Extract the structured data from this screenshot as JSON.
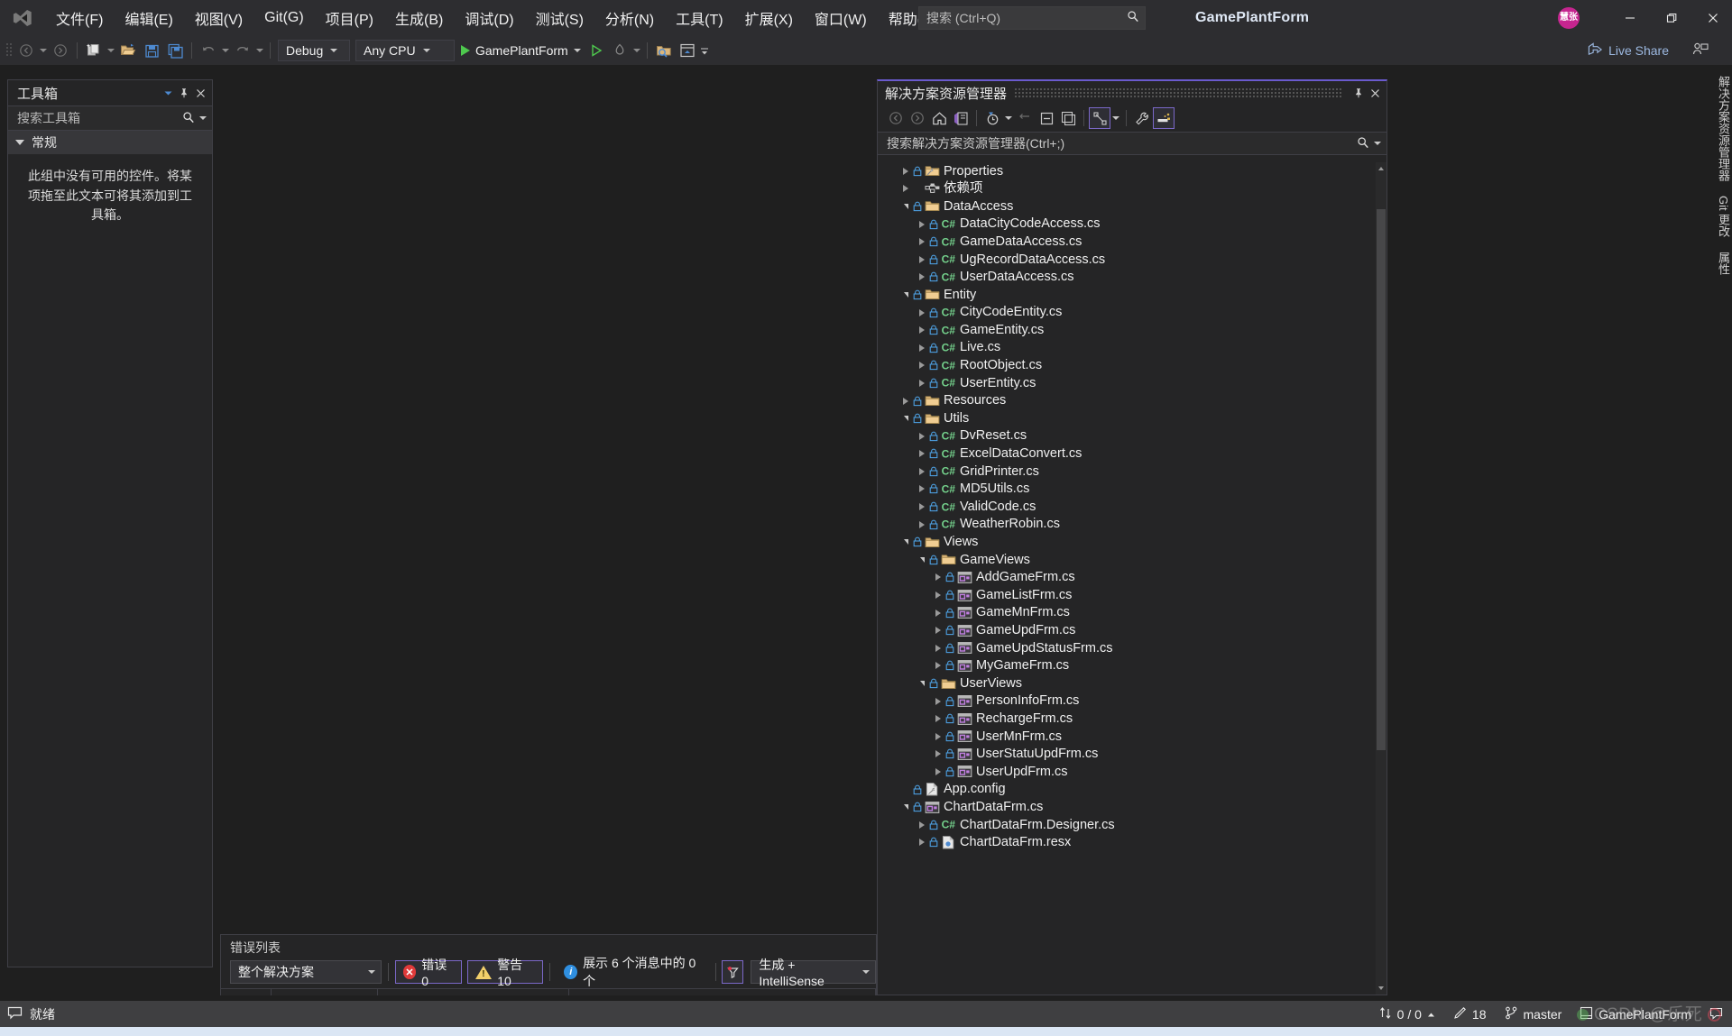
{
  "window": {
    "title": "GamePlantForm",
    "avatar_initials": "慧张",
    "minimize": "—",
    "maximize": "❐",
    "close": "✕"
  },
  "menu": {
    "items": [
      {
        "label": "文件(F)",
        "name": "menu-file"
      },
      {
        "label": "编辑(E)",
        "name": "menu-edit"
      },
      {
        "label": "视图(V)",
        "name": "menu-view"
      },
      {
        "label": "Git(G)",
        "name": "menu-git"
      },
      {
        "label": "项目(P)",
        "name": "menu-project"
      },
      {
        "label": "生成(B)",
        "name": "menu-build"
      },
      {
        "label": "调试(D)",
        "name": "menu-debug"
      },
      {
        "label": "测试(S)",
        "name": "menu-test"
      },
      {
        "label": "分析(N)",
        "name": "menu-analyze"
      },
      {
        "label": "工具(T)",
        "name": "menu-tools"
      },
      {
        "label": "扩展(X)",
        "name": "menu-extensions"
      },
      {
        "label": "窗口(W)",
        "name": "menu-window"
      },
      {
        "label": "帮助(H)",
        "name": "menu-help"
      }
    ]
  },
  "quick_search": {
    "placeholder": "搜索 (Ctrl+Q)",
    "icon": "search-icon"
  },
  "toolbar": {
    "configuration": "Debug",
    "platform": "Any CPU",
    "start_label": "GamePlantForm",
    "live_share": "Live Share"
  },
  "toolbox": {
    "title": "工具箱",
    "search_placeholder": "搜索工具箱",
    "group_label": "常规",
    "empty_message": "此组中没有可用的控件。将某项拖至此文本可将其添加到工具箱。"
  },
  "solution_explorer": {
    "title": "解决方案资源管理器",
    "search_placeholder": "搜索解决方案资源管理器(Ctrl+;)",
    "tree": [
      {
        "label": "Properties",
        "depth": 1,
        "state": "collapsed",
        "icon": "properties-folder-icon",
        "lock": true
      },
      {
        "label": "依赖项",
        "depth": 1,
        "state": "collapsed",
        "icon": "dependencies-icon",
        "lock": false
      },
      {
        "label": "DataAccess",
        "depth": 1,
        "state": "expanded",
        "icon": "folder-icon",
        "lock": true
      },
      {
        "label": "DataCityCodeAccess.cs",
        "depth": 2,
        "state": "collapsed",
        "icon": "csharp-icon",
        "lock": true
      },
      {
        "label": "GameDataAccess.cs",
        "depth": 2,
        "state": "collapsed",
        "icon": "csharp-icon",
        "lock": true
      },
      {
        "label": "UgRecordDataAccess.cs",
        "depth": 2,
        "state": "collapsed",
        "icon": "csharp-icon",
        "lock": true
      },
      {
        "label": "UserDataAccess.cs",
        "depth": 2,
        "state": "collapsed",
        "icon": "csharp-icon",
        "lock": true
      },
      {
        "label": "Entity",
        "depth": 1,
        "state": "expanded",
        "icon": "folder-icon",
        "lock": true
      },
      {
        "label": "CityCodeEntity.cs",
        "depth": 2,
        "state": "collapsed",
        "icon": "csharp-icon",
        "lock": true
      },
      {
        "label": "GameEntity.cs",
        "depth": 2,
        "state": "collapsed",
        "icon": "csharp-icon",
        "lock": true
      },
      {
        "label": "Live.cs",
        "depth": 2,
        "state": "collapsed",
        "icon": "csharp-icon",
        "lock": true
      },
      {
        "label": "RootObject.cs",
        "depth": 2,
        "state": "collapsed",
        "icon": "csharp-icon",
        "lock": true
      },
      {
        "label": "UserEntity.cs",
        "depth": 2,
        "state": "collapsed",
        "icon": "csharp-icon",
        "lock": true
      },
      {
        "label": "Resources",
        "depth": 1,
        "state": "collapsed",
        "icon": "folder-icon",
        "lock": true
      },
      {
        "label": "Utils",
        "depth": 1,
        "state": "expanded",
        "icon": "folder-icon",
        "lock": true
      },
      {
        "label": "DvReset.cs",
        "depth": 2,
        "state": "collapsed",
        "icon": "csharp-icon",
        "lock": true
      },
      {
        "label": "ExcelDataConvert.cs",
        "depth": 2,
        "state": "collapsed",
        "icon": "csharp-icon",
        "lock": true
      },
      {
        "label": "GridPrinter.cs",
        "depth": 2,
        "state": "collapsed",
        "icon": "csharp-icon",
        "lock": true
      },
      {
        "label": "MD5Utils.cs",
        "depth": 2,
        "state": "collapsed",
        "icon": "csharp-icon",
        "lock": true
      },
      {
        "label": "ValidCode.cs",
        "depth": 2,
        "state": "collapsed",
        "icon": "csharp-icon",
        "lock": true
      },
      {
        "label": "WeatherRobin.cs",
        "depth": 2,
        "state": "collapsed",
        "icon": "csharp-icon",
        "lock": true
      },
      {
        "label": "Views",
        "depth": 1,
        "state": "expanded",
        "icon": "folder-icon",
        "lock": true
      },
      {
        "label": "GameViews",
        "depth": 2,
        "state": "expanded",
        "icon": "folder-icon",
        "lock": true
      },
      {
        "label": "AddGameFrm.cs",
        "depth": 3,
        "state": "collapsed",
        "icon": "winform-icon",
        "lock": true
      },
      {
        "label": "GameListFrm.cs",
        "depth": 3,
        "state": "collapsed",
        "icon": "winform-icon",
        "lock": true
      },
      {
        "label": "GameMnFrm.cs",
        "depth": 3,
        "state": "collapsed",
        "icon": "winform-icon",
        "lock": true
      },
      {
        "label": "GameUpdFrm.cs",
        "depth": 3,
        "state": "collapsed",
        "icon": "winform-icon",
        "lock": true
      },
      {
        "label": "GameUpdStatusFrm.cs",
        "depth": 3,
        "state": "collapsed",
        "icon": "winform-icon",
        "lock": true
      },
      {
        "label": "MyGameFrm.cs",
        "depth": 3,
        "state": "collapsed",
        "icon": "winform-icon",
        "lock": true
      },
      {
        "label": "UserViews",
        "depth": 2,
        "state": "expanded",
        "icon": "folder-icon",
        "lock": true
      },
      {
        "label": "PersonInfoFrm.cs",
        "depth": 3,
        "state": "collapsed",
        "icon": "winform-icon",
        "lock": true
      },
      {
        "label": "RechargeFrm.cs",
        "depth": 3,
        "state": "collapsed",
        "icon": "winform-icon",
        "lock": true
      },
      {
        "label": "UserMnFrm.cs",
        "depth": 3,
        "state": "collapsed",
        "icon": "winform-icon",
        "lock": true
      },
      {
        "label": "UserStatuUpdFrm.cs",
        "depth": 3,
        "state": "collapsed",
        "icon": "winform-icon",
        "lock": true
      },
      {
        "label": "UserUpdFrm.cs",
        "depth": 3,
        "state": "collapsed",
        "icon": "winform-icon",
        "lock": true
      },
      {
        "label": "App.config",
        "depth": 1,
        "state": "leaf",
        "icon": "config-icon",
        "lock": true
      },
      {
        "label": "ChartDataFrm.cs",
        "depth": 1,
        "state": "expanded",
        "icon": "winform-icon",
        "lock": true
      },
      {
        "label": "ChartDataFrm.Designer.cs",
        "depth": 2,
        "state": "collapsed",
        "icon": "csharp-icon",
        "lock": true
      },
      {
        "label": "ChartDataFrm.resx",
        "depth": 2,
        "state": "collapsed",
        "icon": "resx-icon",
        "lock": true
      }
    ]
  },
  "right_tabs": [
    {
      "label": "解决方案资源管理器",
      "name": "vtab-solution-explorer"
    },
    {
      "label": "Git 更改",
      "name": "vtab-git-changes"
    },
    {
      "label": "属性",
      "name": "vtab-properties"
    }
  ],
  "error_list": {
    "title": "错误列表",
    "scope": "整个解决方案",
    "errors_label": "错误 0",
    "warnings_label": "警告 10",
    "messages_label": "展示 6 个消息中的 0 个",
    "build_filter": "生成 + IntelliSense"
  },
  "status_bar": {
    "ready": "就绪",
    "sync": "0 / 0",
    "pending_changes": "18",
    "branch": "master",
    "repo": "GamePlantForm",
    "watermark": "CSDN @乐死"
  }
}
